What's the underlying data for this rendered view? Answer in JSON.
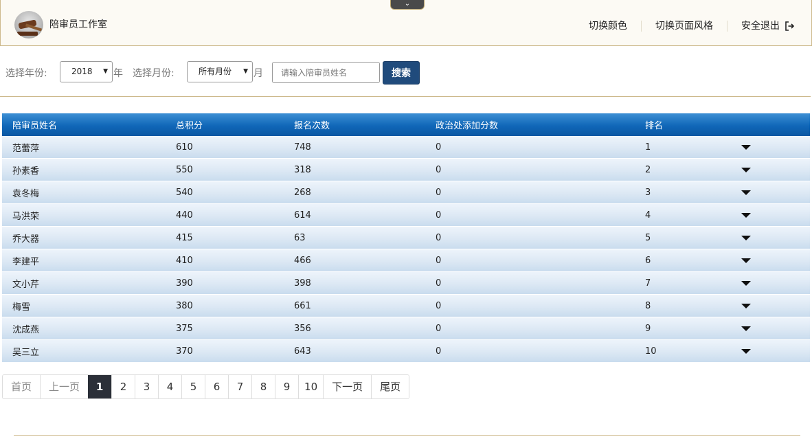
{
  "header": {
    "title": "陪审员工作室",
    "nav": [
      "切换颜色",
      "切换页面风格",
      "安全退出"
    ],
    "collapse_glyph": "⌄"
  },
  "filter": {
    "year_label": "选择年份:",
    "year_value": "2018",
    "year_suffix": "年",
    "month_label": "选择月份:",
    "month_value": "所有月份",
    "month_suffix": "月",
    "name_placeholder": "请输入陪审员姓名",
    "search_label": "搜索"
  },
  "table": {
    "columns": [
      "陪审员姓名",
      "总积分",
      "报名次数",
      "政治处添加分数",
      "排名"
    ],
    "rows": [
      [
        "范蕾萍",
        "610",
        "748",
        "0",
        "1"
      ],
      [
        "孙素香",
        "550",
        "318",
        "0",
        "2"
      ],
      [
        "袁冬梅",
        "540",
        "268",
        "0",
        "3"
      ],
      [
        "马洪荣",
        "440",
        "614",
        "0",
        "4"
      ],
      [
        "乔大器",
        "415",
        "63",
        "0",
        "5"
      ],
      [
        "李建平",
        "410",
        "466",
        "0",
        "6"
      ],
      [
        "文小芹",
        "390",
        "398",
        "0",
        "7"
      ],
      [
        "梅雪",
        "380",
        "661",
        "0",
        "8"
      ],
      [
        "沈成燕",
        "375",
        "356",
        "0",
        "9"
      ],
      [
        "吴三立",
        "370",
        "643",
        "0",
        "10"
      ]
    ]
  },
  "pagination": {
    "first": "首页",
    "prev": "上一页",
    "pages": [
      "1",
      "2",
      "3",
      "4",
      "5",
      "6",
      "7",
      "8",
      "9",
      "10"
    ],
    "current": "1",
    "next": "下一页",
    "last": "尾页"
  },
  "colors": {
    "accent_border": "#cdb98c",
    "header_bg": "#fcfaf4",
    "button": "#204b7c",
    "table_header": "#1067b8",
    "active_page": "#2b2f38"
  }
}
